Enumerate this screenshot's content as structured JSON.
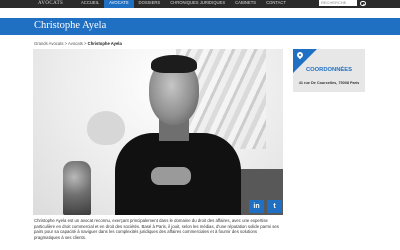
{
  "header": {
    "logo_text": "AVOCATS",
    "nav": [
      "ACCUEIL",
      "AVOCATS",
      "DOSSIERS",
      "CHRONIQUES JURIDIQUES",
      "CABINETS",
      "CONTACT"
    ],
    "active_nav": "AVOCATS",
    "search_placeholder": "RECHERCHE"
  },
  "page": {
    "title": "Christophe Ayela",
    "breadcrumb": [
      "Grands Avocats",
      "Avocats",
      "Christophe Ayela"
    ],
    "breadcrumb_separator": ">"
  },
  "social": [
    {
      "label": "in",
      "icon": "linkedin-icon"
    },
    {
      "label": "t",
      "icon": "twitter-icon"
    }
  ],
  "contact_card": {
    "title": "COORDONNÉES",
    "address": "41 rue De Courcelles, 75008 Paris"
  },
  "bio": "Christophe Ayela est un avocat reconnu, exerçant principalement dans le domaine du droit des affaires, avec une expertise particulière en droit commercial et en droit des sociétés. Basé à Paris, il jouit, selon les médias, d'une réputation solide parmi ses pairs pour sa capacité à naviguer dans les complexités juridiques des affaires commerciales et à fournir des solutions pragmatiques à ses clients.",
  "colors": {
    "accent": "#1f6fc2",
    "topbar": "#2b2b2b",
    "card_bg": "#e7e7e7"
  }
}
